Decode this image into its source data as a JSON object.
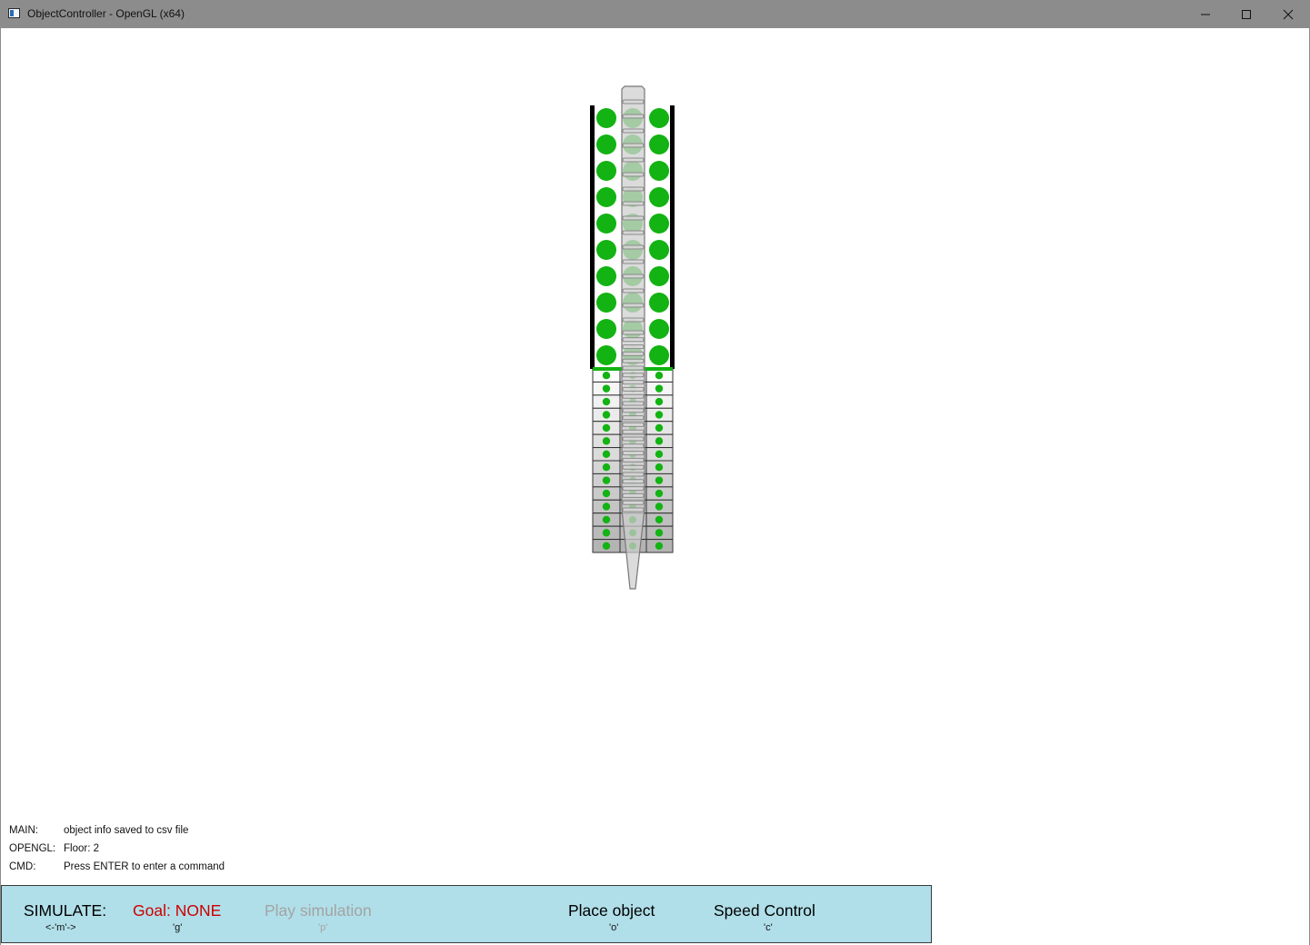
{
  "window": {
    "title": "ObjectController - OpenGL (x64)"
  },
  "log": [
    {
      "key": "MAIN:",
      "value": "object info saved to csv file"
    },
    {
      "key": "OPENGL:",
      "value": "Floor: 2"
    },
    {
      "key": "CMD:",
      "value": "Press ENTER to enter a command"
    }
  ],
  "menu": {
    "simulate": {
      "label": "SIMULATE:",
      "key": "<-'m'->"
    },
    "goal": {
      "label": "Goal: NONE",
      "key": "'g'"
    },
    "play": {
      "label": "Play simulation",
      "key": "'p'"
    },
    "place": {
      "label": "Place object",
      "key": "'o'"
    },
    "speed": {
      "label": "Speed Control",
      "key": "'c'"
    }
  },
  "colors": {
    "green": "#12b312",
    "menu_bg": "#b0dfe9",
    "goal_red": "#cc0000",
    "disabled_gray": "#a3a3a3"
  }
}
